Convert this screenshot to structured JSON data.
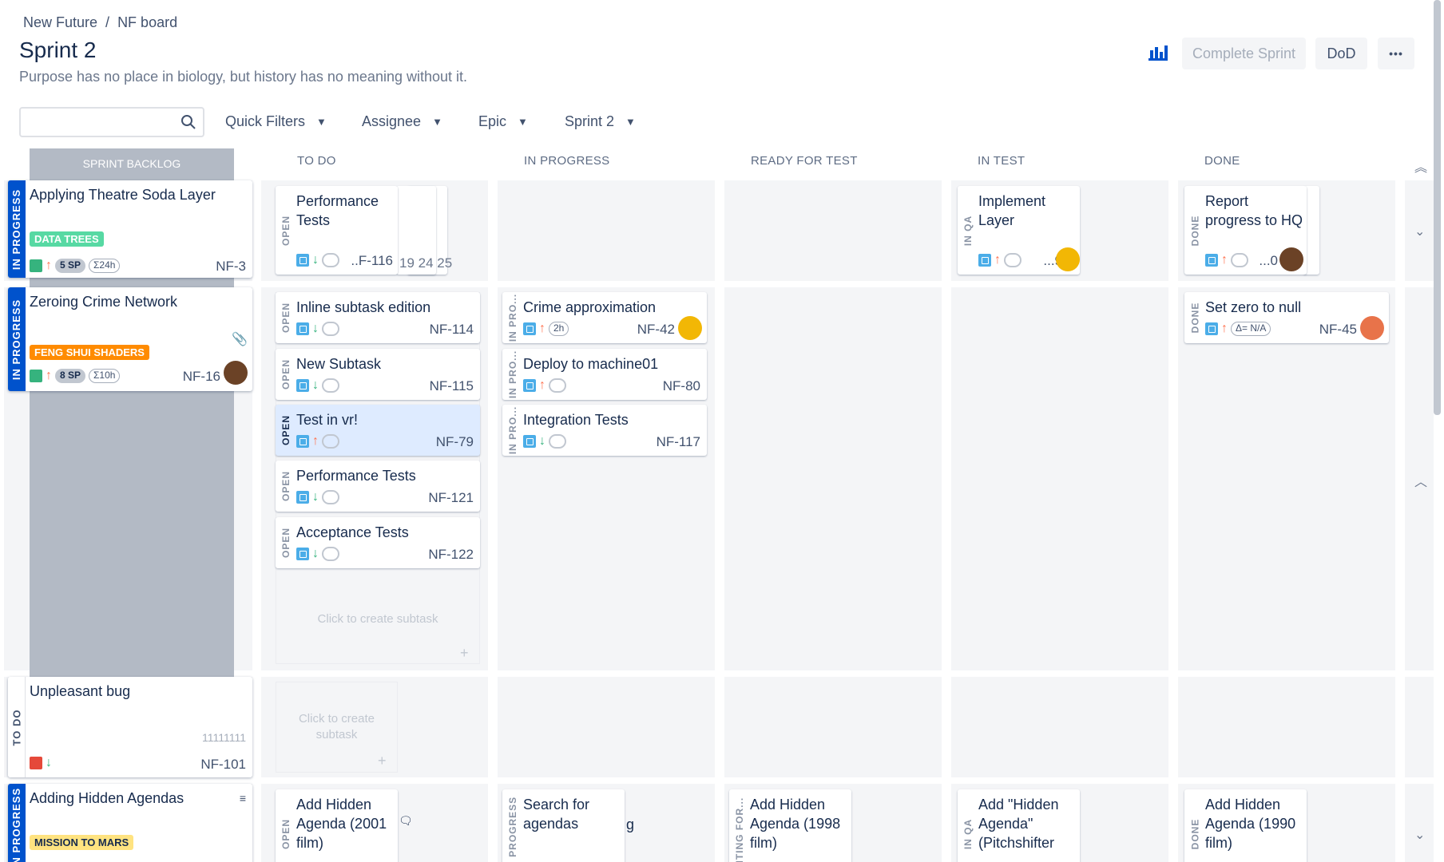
{
  "breadcrumb": {
    "project": "New Future",
    "board": "NF board",
    "separator": "/"
  },
  "sprint": {
    "title": "Sprint 2",
    "goal": "Purpose has no place in biology, but history has no meaning without it."
  },
  "header_buttons": {
    "complete_sprint": "Complete Sprint",
    "dod": "DoD",
    "more": "•••"
  },
  "search": {
    "placeholder": "",
    "value": ""
  },
  "filters": {
    "quick_filters": "Quick Filters",
    "assignee": "Assignee",
    "epic": "Epic",
    "sprint": "Sprint 2"
  },
  "columns": [
    "SPRINT BACKLOG",
    "TO DO",
    "IN PROGRESS",
    "READY FOR TEST",
    "IN TEST",
    "DONE"
  ],
  "colors": {
    "accent": "#0052cc",
    "epic_green": "#57d9a3",
    "epic_orange": "#ff8b00",
    "epic_yellow": "#ffe380"
  },
  "rows": {
    "r1": {
      "parent": {
        "status": "IN PROGRESS",
        "title": "Applying Theatre Soda Layer",
        "epic": "DATA TREES",
        "sp": "5 SP",
        "est": "Σ24h",
        "key": "NF-3"
      },
      "todo": {
        "status": "OPEN",
        "title": "Performance Tests",
        "key": "..F-116",
        "stack_keys": "19  24  25"
      },
      "intest": {
        "status": "IN QA",
        "title": "Implement Layer",
        "key": "...9"
      },
      "done": {
        "status": "DONE",
        "title": "Report progress to HQ",
        "key": "...0"
      }
    },
    "r2": {
      "parent": {
        "status": "IN PROGRESS",
        "title": "Zeroing Crime Network",
        "epic": "FENG SHUI SHADERS",
        "sp": "8 SP",
        "est": "Σ10h",
        "key": "NF-16"
      },
      "todo": [
        {
          "status": "OPEN",
          "title": "Inline subtask edition",
          "key": "NF-114"
        },
        {
          "status": "OPEN",
          "title": "New Subtask",
          "key": "NF-115"
        },
        {
          "status": "OPEN",
          "title": "Test in vr!",
          "key": "NF-79"
        },
        {
          "status": "OPEN",
          "title": "Performance Tests",
          "key": "NF-121"
        },
        {
          "status": "OPEN",
          "title": "Acceptance Tests",
          "key": "NF-122"
        }
      ],
      "inprogress": [
        {
          "status": "IN PRO...",
          "title": "Crime approximation",
          "key": "NF-42",
          "est": "2h"
        },
        {
          "status": "IN PRO...",
          "title": "Deploy to machine01",
          "key": "NF-80"
        },
        {
          "status": "IN PRO...",
          "title": "Integration Tests",
          "key": "NF-117"
        }
      ],
      "done": {
        "status": "DONE",
        "title": "Set zero to null",
        "key": "NF-45",
        "est": "Δ= N/A"
      },
      "create_hint": "Click to create subtask"
    },
    "r3": {
      "parent": {
        "status": "TO DO",
        "title": "Unpleasant bug",
        "number": "11111111",
        "key": "NF-101"
      },
      "create_hint": "Click to create subtask"
    },
    "r4": {
      "parent": {
        "status": "IN PROGRESS",
        "title": "Adding Hidden Agendas",
        "epic": "MISSION TO MARS"
      },
      "todo": {
        "status": "OPEN",
        "title": "Add Hidden Agenda (2001 film)"
      },
      "inprogress": {
        "status": "IN PROGRESS",
        "title": "Search for agendas",
        "extra": "g"
      },
      "ready": {
        "status": "AITING FOR...",
        "title": "Add Hidden Agenda (1998 film)"
      },
      "intest": {
        "status": "IN QA",
        "title": "Add \"Hidden Agenda\" (Pitchshifter"
      },
      "done": {
        "status": "DONE",
        "title": "Add Hidden Agenda (1990 film)"
      }
    }
  }
}
